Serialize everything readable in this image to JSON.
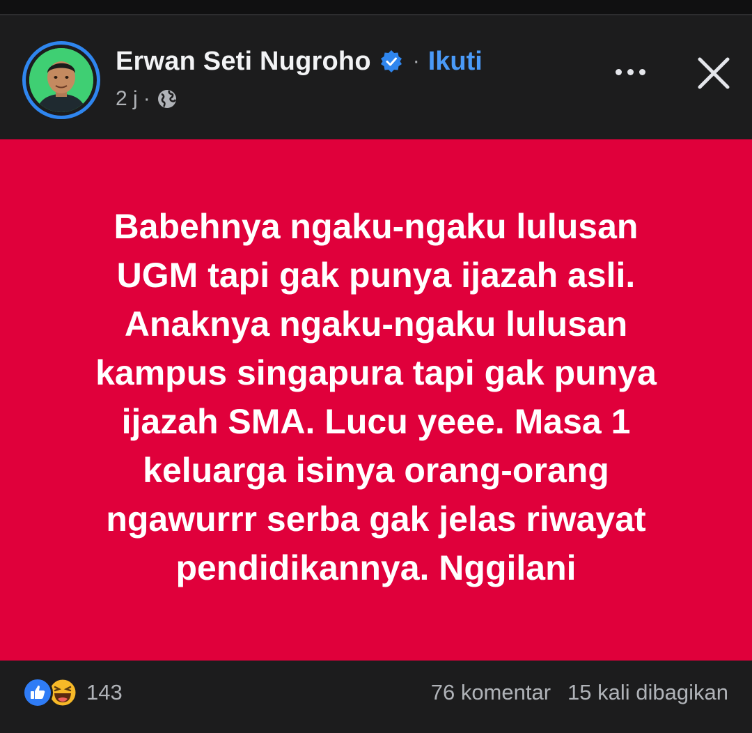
{
  "post": {
    "author": "Erwan Seti Nugroho",
    "separator": "·",
    "follow_label": "Ikuti",
    "time": "2 j",
    "time_separator": "·",
    "text": "Babehnya ngaku-ngaku lulusan\nUGM tapi gak punya ijazah asli.\nAnaknya ngaku-ngaku lulusan\nkampus singapura tapi gak punya\nijazah SMA. Lucu yeee. Masa 1\nkeluarga isinya orang-orang\nngawurrr serba gak jelas riwayat\npendidikannya. Nggilani",
    "background_color": "#e0003b"
  },
  "footer": {
    "reaction_count": "143",
    "comments": "76 komentar",
    "shares": "15 kali dibagikan"
  },
  "icons": {
    "verified": "verified-badge-icon",
    "privacy": "globe-icon",
    "more": "more-options-icon",
    "close": "close-icon",
    "like": "like-reaction-icon",
    "haha": "haha-reaction-icon"
  },
  "colors": {
    "accent": "#4a9af8",
    "avatar_ring": "#2f86ef",
    "text_primary": "#f2f3f5",
    "text_secondary": "#b0b3b8"
  }
}
